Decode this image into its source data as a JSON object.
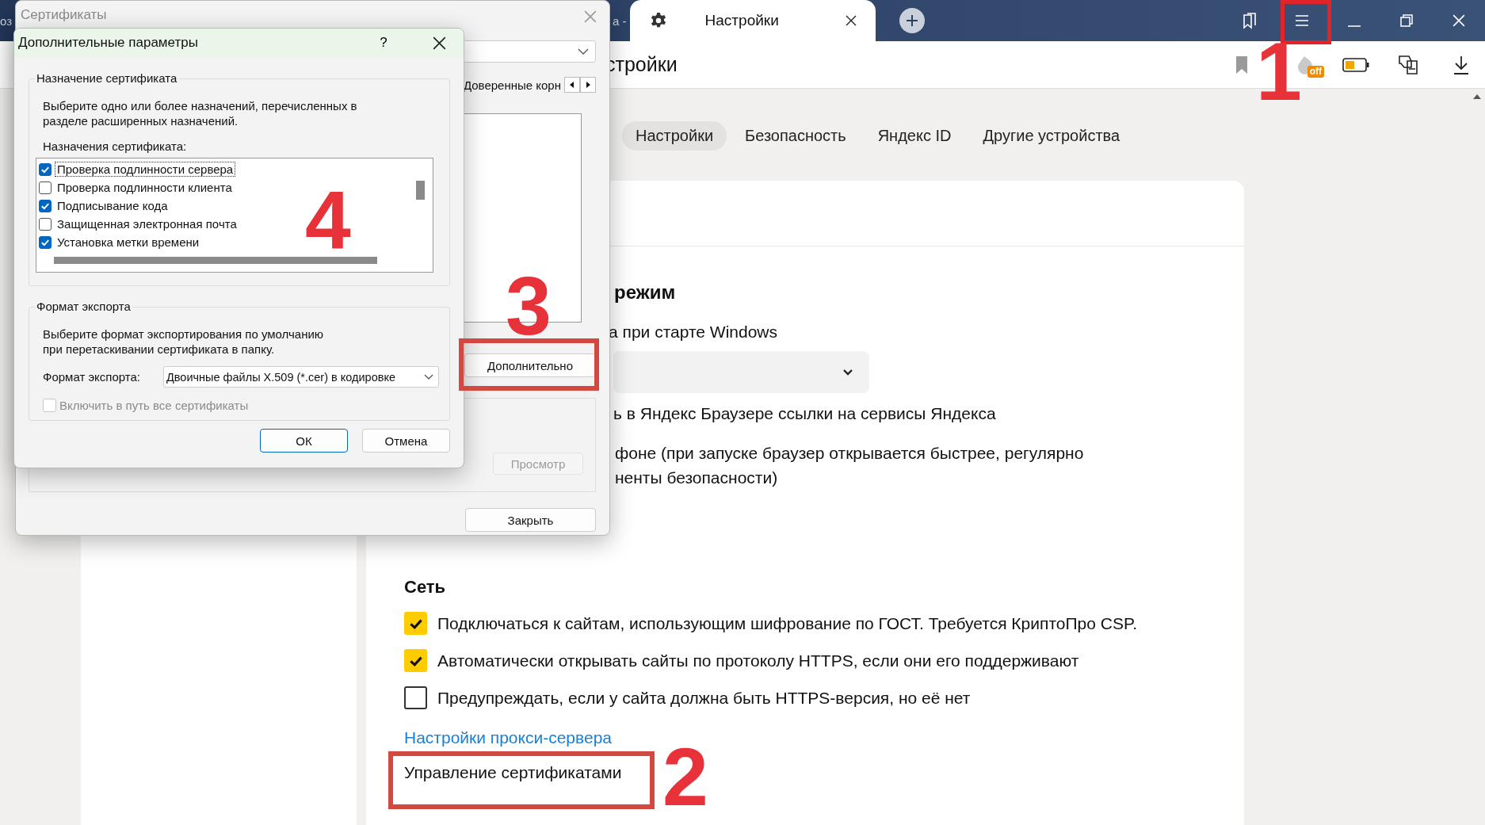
{
  "browser": {
    "tab_fragments": [
      "оз",
      "а -"
    ],
    "active_tab": {
      "title": "Настройки"
    },
    "page_title_fragment": "стройки",
    "extension_badge": "off",
    "settings_tabs": [
      {
        "label": "Настройки",
        "selected": true
      },
      {
        "label": "Безопасность",
        "selected": false
      },
      {
        "label": "Яндекс ID",
        "selected": false
      },
      {
        "label": "Другие устройства",
        "selected": false
      }
    ],
    "section_fragment": {
      "heading": "режим",
      "startup_line": "а при старте Windows",
      "links_line": "ь в Яндекс Браузере ссылки на сервисы Яндекса",
      "background_lines": [
        "фоне (при запуске браузер открывается быстрее, регулярно",
        "ненты безопасности)"
      ]
    },
    "network": {
      "title": "Сеть",
      "options": [
        {
          "label": "Подключаться к сайтам, использующим шифрование по ГОСТ. Требуется КриптоПро CSP.",
          "checked": true
        },
        {
          "label": "Автоматически открывать сайты по протоколу HTTPS, если они его поддерживают",
          "checked": true
        },
        {
          "label": "Предупреждать, если у сайта должна быть HTTPS-версия, но её нет",
          "checked": false
        }
      ],
      "proxy_link": "Настройки прокси-сервера",
      "certificates_link": "Управление сертификатами"
    }
  },
  "certificates_window": {
    "title": "Сертификаты",
    "tab_fragment": "Доверенные корн",
    "advanced_button": "Дополнительно",
    "view_button": {
      "label": "Просмотр",
      "disabled": true
    },
    "close_button": "Закрыть"
  },
  "advanced_dialog": {
    "title": "Дополнительные параметры",
    "help": "?",
    "purpose_group": {
      "title": "Назначение сертификата",
      "description": "Выберите одно или более назначений, перечисленных в разделе расширенных назначений.",
      "list_label": "Назначения сертификата:",
      "items": [
        {
          "label": "Проверка подлинности сервера",
          "checked": true,
          "focused": true
        },
        {
          "label": "Проверка подлинности клиента",
          "checked": false,
          "focused": false
        },
        {
          "label": "Подписывание кода",
          "checked": true,
          "focused": false
        },
        {
          "label": "Защищенная электронная почта",
          "checked": false,
          "focused": false
        },
        {
          "label": "Установка метки времени",
          "checked": true,
          "focused": false
        }
      ]
    },
    "export_group": {
      "title": "Формат экспорта",
      "description": "Выберите формат экспортирования по умолчанию при перетаскивании сертификата в папку.",
      "format_label": "Формат экспорта:",
      "format_value": "Двоичные файлы X.509 (*.cer) в кодировке",
      "include_all": {
        "label": "Включить в путь все сертификаты",
        "checked": false,
        "disabled": true
      }
    },
    "buttons": [
      "ОК",
      "Отмена"
    ]
  },
  "annotations": [
    "1",
    "4",
    "3",
    "2"
  ]
}
